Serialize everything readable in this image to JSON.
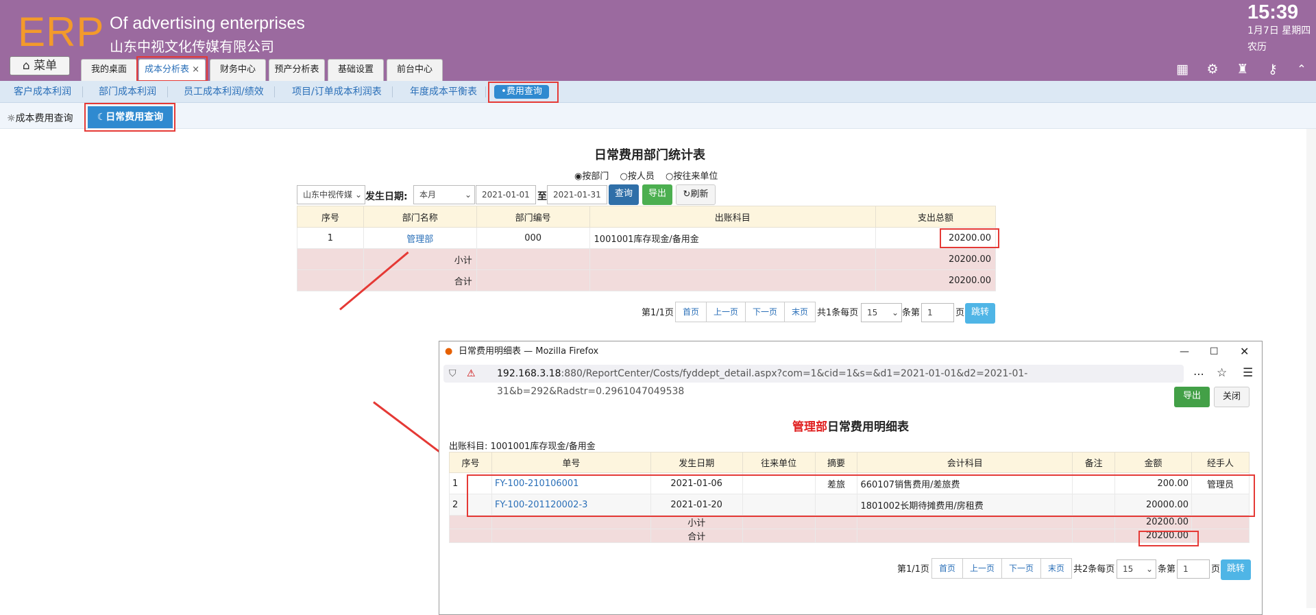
{
  "header": {
    "logo": "ERP",
    "slogan": "Of advertising enterprises",
    "company": "山东中视文化传媒有限公司",
    "time": "15:39",
    "date": "1月7日 星期四",
    "lunar": "农历",
    "menu_label": "菜单",
    "tabs": [
      {
        "label": "我的桌面"
      },
      {
        "label": "成本分析表",
        "close": "×"
      },
      {
        "label": "财务中心"
      },
      {
        "label": "预产分析表"
      },
      {
        "label": "基础设置"
      },
      {
        "label": "前台中心"
      }
    ]
  },
  "subnav": {
    "items": [
      "客户成本利润",
      "部门成本利润",
      "员工成本利润/绩效",
      "项目/订单成本利润表",
      "年度成本平衡表"
    ],
    "active": "•费用查询"
  },
  "secondary_tabs": {
    "cost_query": "成本费用查询",
    "daily_query": "日常费用查询"
  },
  "report": {
    "title": "日常费用部门统计表",
    "radio_options": [
      "按部门",
      "按人员",
      "按往来单位"
    ],
    "company_select": "山东中视传媒",
    "date_label": "发生日期:",
    "period_select": "本月",
    "date_from": "2021-01-01",
    "to_label": "至",
    "date_to": "2021-01-31",
    "query_btn": "查询",
    "export_btn": "导出",
    "refresh_btn": "刷新",
    "columns": [
      "序号",
      "部门名称",
      "部门编号",
      "出账科目",
      "支出总额"
    ],
    "rows": [
      {
        "no": "1",
        "dept": "管理部",
        "code": "000",
        "account": "1001001库存现金/备用金",
        "total": "20200.00"
      }
    ],
    "subtotal_label": "小计",
    "subtotal": "20200.00",
    "total_label": "合计",
    "total": "20200.00",
    "pager": {
      "page_info": "第1/1页",
      "first": "首页",
      "prev": "上一页",
      "next": "下一页",
      "last": "末页",
      "count": "共1条每页",
      "per_page": "15",
      "goto_label": "条第",
      "goto_value": "1",
      "page_suffix": "页",
      "jump": "跳转"
    }
  },
  "firefox": {
    "title": "日常费用明细表 — Mozilla Firefox",
    "url_host": "192.168.3.18",
    "url_rest": ":880/ReportCenter/Costs/fyddept_detail.aspx?com=1&cid=1&s=&d1=2021-01-01&d2=2021-01-31&b=292&Radstr=0.2961047049538",
    "export_btn": "导出",
    "close_btn": "关闭",
    "title_dept": "管理部",
    "title_rest": "日常费用明细表",
    "account_label": "出账科目: 1001001库存现金/备用金",
    "columns": [
      "序号",
      "单号",
      "发生日期",
      "往来单位",
      "摘要",
      "会计科目",
      "备注",
      "金额",
      "经手人"
    ],
    "rows": [
      {
        "no": "1",
        "doc": "FY-100-210106001",
        "date": "2021-01-06",
        "partner": "",
        "summary": "差旅",
        "account": "660107销售费用/差旅费",
        "note": "",
        "amount": "200.00",
        "handler": "管理员"
      },
      {
        "no": "2",
        "doc": "FY-100-201120002-3",
        "date": "2021-01-20",
        "partner": "",
        "summary": "",
        "account": "1801002长期待摊费用/房租费",
        "note": "",
        "amount": "20000.00",
        "handler": ""
      }
    ],
    "subtotal_label": "小计",
    "subtotal": "20200.00",
    "total_label": "合计",
    "total": "20200.00",
    "pager": {
      "page_info": "第1/1页",
      "first": "首页",
      "prev": "上一页",
      "next": "下一页",
      "last": "末页",
      "count": "共2条每页",
      "per_page": "15",
      "goto_label": "条第",
      "goto_value": "1",
      "page_suffix": "页",
      "jump": "跳转"
    }
  }
}
